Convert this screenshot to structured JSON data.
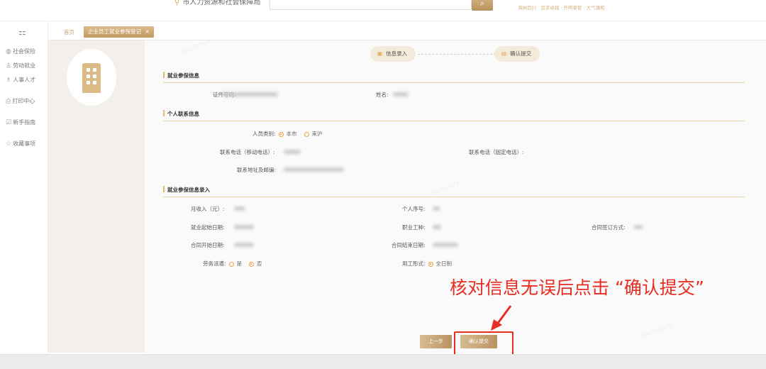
{
  "header": {
    "location": "市人力资源和社会保障局",
    "motto": "海纳百川 · 追求卓越 · 开明睿智 · 大气谦和"
  },
  "sidebar": {
    "items": [
      {
        "icon": "globe-icon",
        "label": "社会保险"
      },
      {
        "icon": "person-icon",
        "label": "劳动就业"
      },
      {
        "icon": "people-icon",
        "label": "人事人才"
      },
      {
        "icon": "printer-icon",
        "label": "打印中心"
      },
      {
        "icon": "guide-icon",
        "label": "新手指南"
      },
      {
        "icon": "star-icon",
        "label": "收藏事项"
      }
    ]
  },
  "tabs": {
    "home": "首页",
    "active": "企业员工就业参保登记",
    "close": "×"
  },
  "steps": [
    "信息录入",
    "确认提交"
  ],
  "sections": {
    "s1": {
      "title": "就业参保信息",
      "id_label": "证件号码:",
      "name_label": "姓名:"
    },
    "s2": {
      "title": "个人联系信息",
      "type_label": "人员类别:",
      "type_opts": [
        "本市",
        "来沪"
      ],
      "mobile_label": "联系电话（移动电话）:",
      "fixed_label": "联系电话（固定电话）:",
      "addr_label": "联系地址及邮编:"
    },
    "s3": {
      "title": "就业参保信息录入",
      "income": "月收入（元）:",
      "serial": "个人序号:",
      "start": "就业起始日期:",
      "job": "职业工种:",
      "sign": "合同签订方式:",
      "cstart": "合同开始日期:",
      "cend": "合同结束日期:",
      "dispatch": "劳务派遣:",
      "dispatch_opts": [
        "是",
        "否"
      ],
      "form": "用工形式:",
      "form_opt": "全日制"
    }
  },
  "buttons": {
    "prev": "上一步",
    "submit": "确认提交"
  },
  "annotation": "核对信息无误后点击 “确认提交”",
  "watermark": "0001057878",
  "colors": {
    "accent": "#c49a61",
    "annotation": "#e62d22"
  }
}
